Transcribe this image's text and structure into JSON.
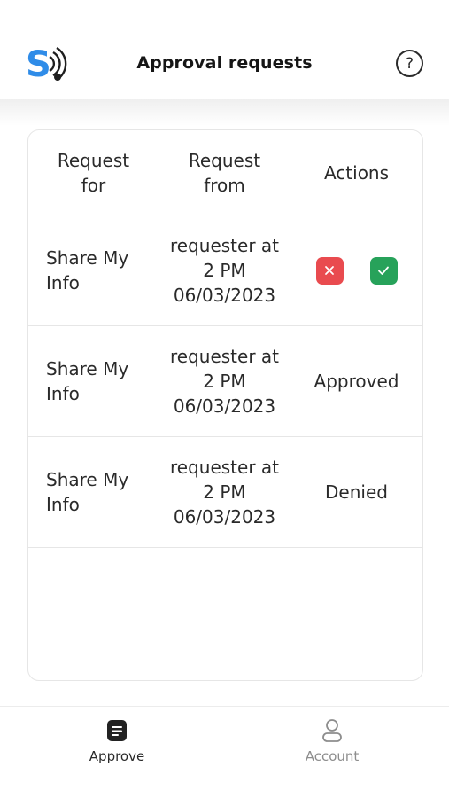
{
  "header": {
    "title": "Approval requests",
    "help_label": "?"
  },
  "table": {
    "columns": [
      "Request\nfor",
      "Request\nfrom",
      "Actions"
    ],
    "rows": [
      {
        "request_for": "Share My\nInfo",
        "request_from": "requester at\n2 PM\n06/03/2023",
        "status": ""
      },
      {
        "request_for": "Share My\nInfo",
        "request_from": "requester at\n2 PM\n06/03/2023",
        "status": "Approved"
      },
      {
        "request_for": "Share My\nInfo",
        "request_from": "requester at\n2 PM\n06/03/2023",
        "status": "Denied"
      }
    ],
    "actions": {
      "deny_icon": "close-icon",
      "approve_icon": "check-icon"
    }
  },
  "tabbar": {
    "tabs": [
      {
        "label": "Approve",
        "icon": "document-icon",
        "active": true
      },
      {
        "label": "Account",
        "icon": "user-icon",
        "active": false
      }
    ]
  },
  "colors": {
    "accent_blue": "#2f8ce8",
    "deny_red": "#e94b4f",
    "approve_green": "#27a25a",
    "inactive_gray": "#8d8d8d"
  }
}
